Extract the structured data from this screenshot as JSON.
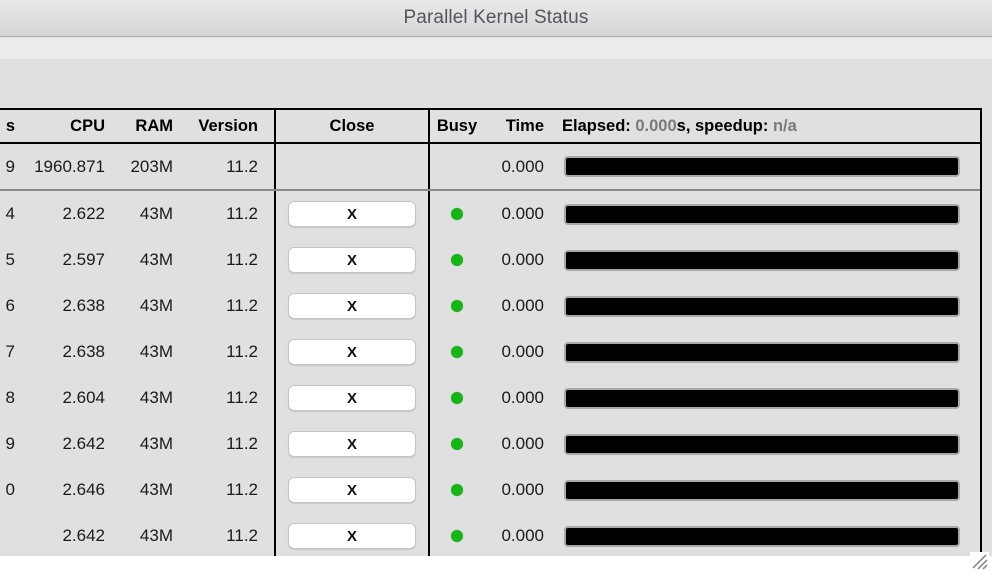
{
  "window": {
    "title": "Parallel Kernel Status"
  },
  "table": {
    "columns": {
      "id": "s",
      "cpu": "CPU",
      "ram": "RAM",
      "version": "Version",
      "close": "Close",
      "busy": "Busy",
      "time": "Time"
    },
    "elapsed": {
      "label_prefix": "Elapsed: ",
      "elapsed_value": "0.000",
      "label_middle": "s, speedup: ",
      "speedup_value": "n/a"
    },
    "close_button_label": "X",
    "summary_row": {
      "id": "9",
      "cpu": "1960.871",
      "ram": "203M",
      "version": "11.2",
      "time": "0.000",
      "has_close": false,
      "busy": false,
      "progress_percent": 100
    },
    "rows": [
      {
        "id": "4",
        "cpu": "2.622",
        "ram": "43M",
        "version": "11.2",
        "time": "0.000",
        "busy": true,
        "progress_percent": 100
      },
      {
        "id": "5",
        "cpu": "2.597",
        "ram": "43M",
        "version": "11.2",
        "time": "0.000",
        "busy": true,
        "progress_percent": 100
      },
      {
        "id": "6",
        "cpu": "2.638",
        "ram": "43M",
        "version": "11.2",
        "time": "0.000",
        "busy": true,
        "progress_percent": 100
      },
      {
        "id": "7",
        "cpu": "2.638",
        "ram": "43M",
        "version": "11.2",
        "time": "0.000",
        "busy": true,
        "progress_percent": 100
      },
      {
        "id": "8",
        "cpu": "2.604",
        "ram": "43M",
        "version": "11.2",
        "time": "0.000",
        "busy": true,
        "progress_percent": 100
      },
      {
        "id": "9",
        "cpu": "2.642",
        "ram": "43M",
        "version": "11.2",
        "time": "0.000",
        "busy": true,
        "progress_percent": 100
      },
      {
        "id": "0",
        "cpu": "2.646",
        "ram": "43M",
        "version": "11.2",
        "time": "0.000",
        "busy": true,
        "progress_percent": 100
      },
      {
        "id": "",
        "cpu": "2.642",
        "ram": "43M",
        "version": "11.2",
        "time": "0.000",
        "busy": true,
        "progress_percent": 100
      }
    ]
  },
  "colors": {
    "busy_led": "#12b812",
    "progress_fill": "#000000",
    "title_text": "#53565a",
    "muted_value": "#7a7a7a"
  },
  "icons": {
    "resize_grip": "resize-grip-icon"
  }
}
